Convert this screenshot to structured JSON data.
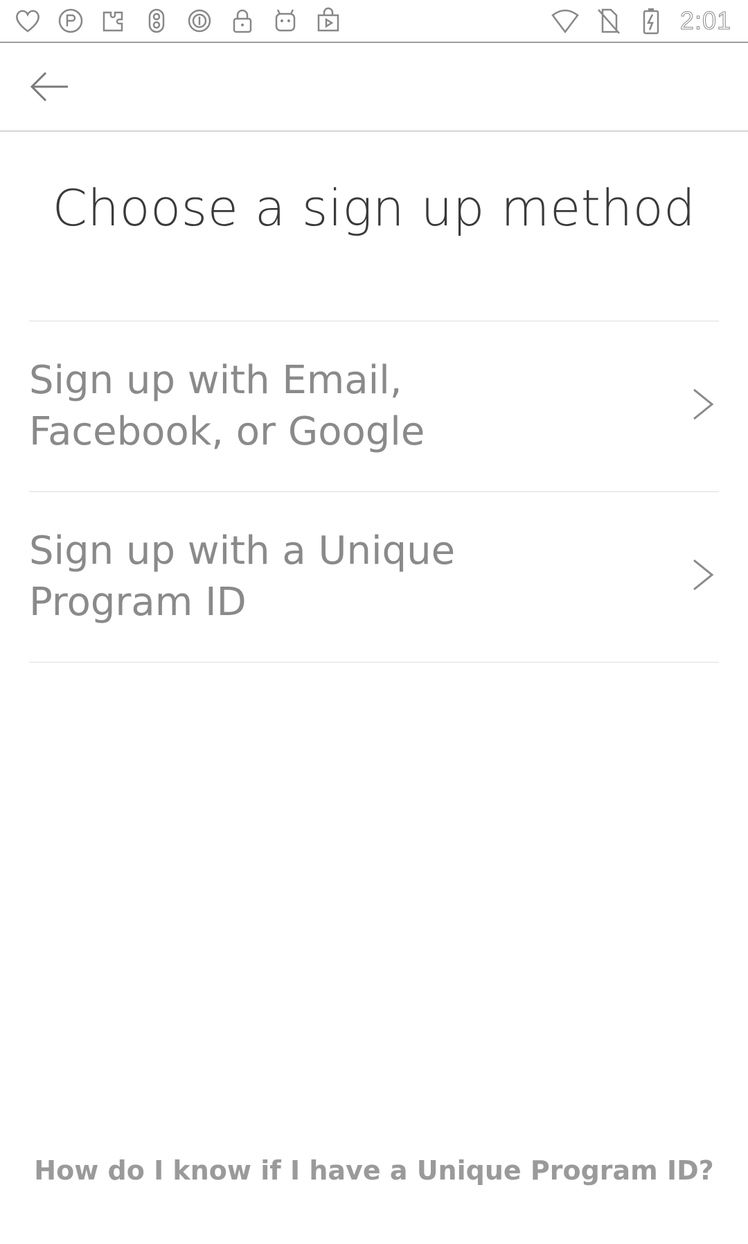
{
  "status_bar": {
    "left_icons": [
      "heart-icon",
      "ps-icon",
      "puzzle-icon",
      "vpn-icon",
      "sync-icon",
      "lock-icon",
      "android-icon",
      "play-store-icon"
    ],
    "right_icons": [
      "wifi-icon",
      "no-sim-icon",
      "battery-charging-icon"
    ],
    "time": "2:01"
  },
  "app_bar": {
    "back_icon": "arrow-left-icon"
  },
  "page": {
    "title": "Choose a sign up method"
  },
  "options": [
    {
      "label": "Sign up with Email,\nFacebook, or Google",
      "icon": "chevron-right-icon"
    },
    {
      "label": "Sign up with a Unique\nProgram ID",
      "icon": "chevron-right-icon"
    }
  ],
  "footer": {
    "help_link": "How do I know if I have a Unique Program ID?"
  },
  "colors": {
    "background": "#ffffff",
    "title_text": "#3a3a3a",
    "option_text": "#8a8a8a",
    "divider": "#ececec",
    "link_text": "#9a9a9a"
  }
}
